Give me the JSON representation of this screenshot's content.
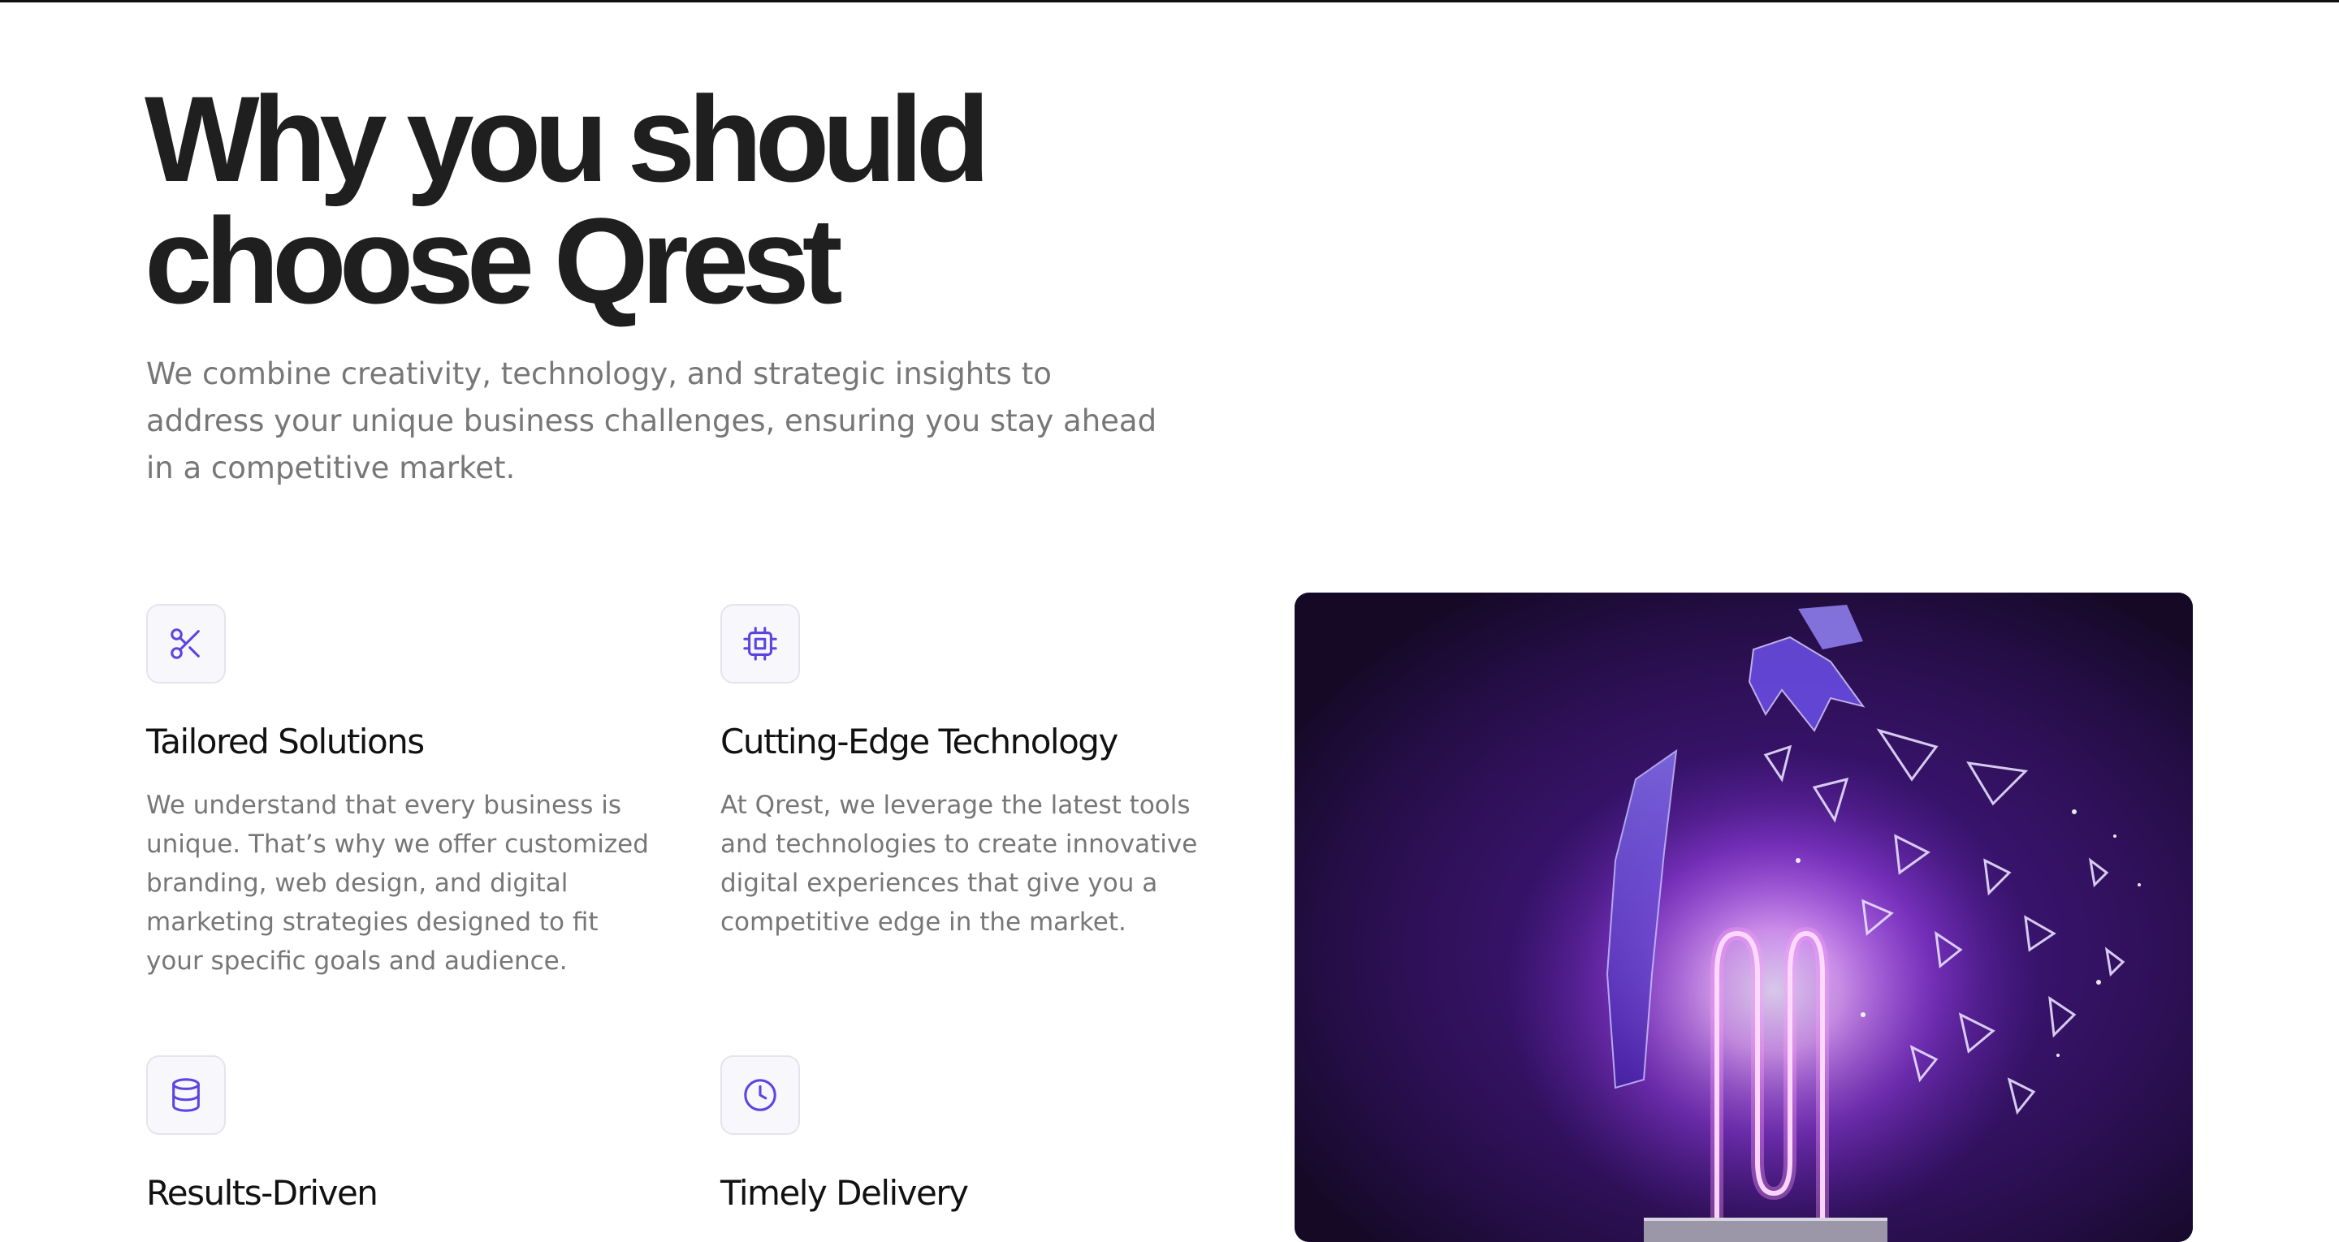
{
  "hero": {
    "title_line1": "Why you should",
    "title_line2": "choose Qrest",
    "subtitle": "We combine creativity, technology, and strategic insights to address your unique business challenges, ensuring you stay ahead in a competitive market."
  },
  "features": [
    {
      "icon": "scissors-icon",
      "title": "Tailored Solutions",
      "description": "We understand that every business is unique. That’s why we offer customized branding, web design, and digital marketing strategies designed to fit your specific goals and audience."
    },
    {
      "icon": "cpu-chip-icon",
      "title": "Cutting-Edge Technology",
      "description": "At Qrest, we leverage the latest tools and technologies to create innovative digital experiences that give you a competitive edge in the market."
    },
    {
      "icon": "database-icon",
      "title": "Results-Driven",
      "description": ""
    },
    {
      "icon": "clock-icon",
      "title": "Timely Delivery",
      "description": ""
    }
  ],
  "colors": {
    "accent": "#5b45e0",
    "heading": "#1f1f1f",
    "body_text": "#777777",
    "icon_bg": "#f8f7fc",
    "image_bg": "#160a26"
  }
}
